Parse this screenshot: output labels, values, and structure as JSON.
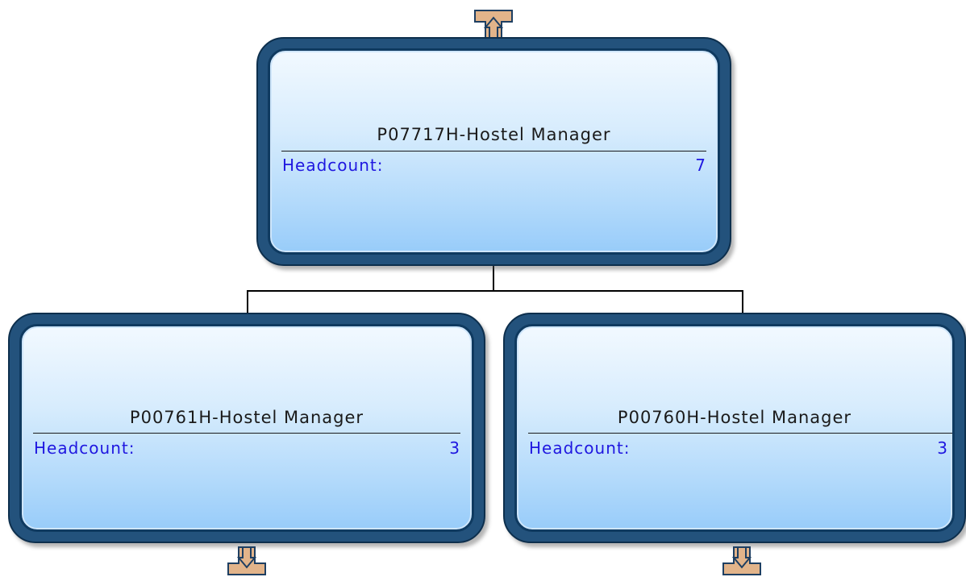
{
  "nodes": {
    "root": {
      "title": "P07717H-Hostel Manager",
      "headcount_label": "Headcount:",
      "headcount_value": "7"
    },
    "left": {
      "title": "P00761H-Hostel Manager",
      "headcount_label": "Headcount:",
      "headcount_value": "3"
    },
    "right": {
      "title": "P00760H-Hostel Manager",
      "headcount_label": "Headcount:",
      "headcount_value": "3"
    }
  },
  "colors": {
    "node_border": "#23527c",
    "node_fill_top": "#f2f9ff",
    "node_fill_bottom": "#98ccf9",
    "headcount_text": "#1f17e0",
    "arrow_fill": "#e2b48a",
    "arrow_stroke": "#1e3f62"
  },
  "icons": {
    "up_arrow": "expand-up-arrow-icon",
    "down_arrow": "expand-down-arrow-icon"
  }
}
